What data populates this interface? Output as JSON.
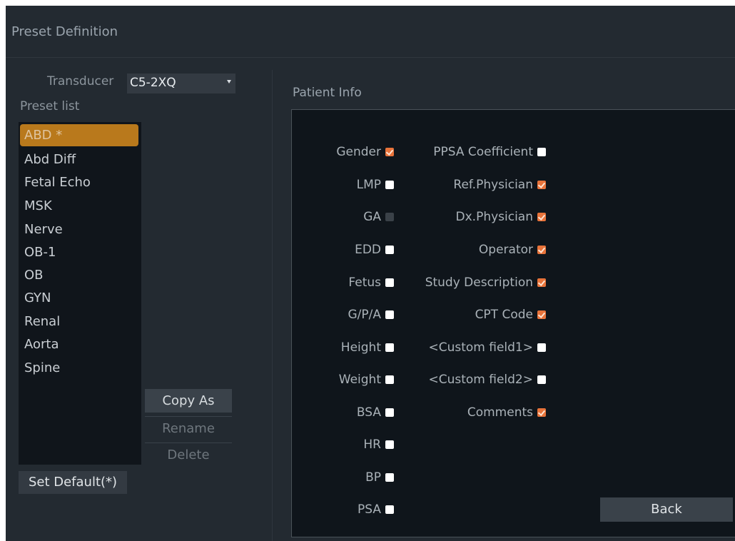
{
  "title": "Preset Definition",
  "transducer": {
    "label": "Transducer",
    "value": "C5-2XQ"
  },
  "preset_list_label": "Preset  list",
  "presets": [
    {
      "label": "ABD *",
      "selected": true
    },
    {
      "label": "Abd Diff",
      "selected": false
    },
    {
      "label": "Fetal Echo",
      "selected": false
    },
    {
      "label": "MSK",
      "selected": false
    },
    {
      "label": "Nerve",
      "selected": false
    },
    {
      "label": "OB-1",
      "selected": false
    },
    {
      "label": "OB",
      "selected": false
    },
    {
      "label": "GYN",
      "selected": false
    },
    {
      "label": "Renal",
      "selected": false
    },
    {
      "label": "Aorta",
      "selected": false
    },
    {
      "label": "Spine",
      "selected": false
    }
  ],
  "buttons": {
    "copy_as": "Copy As",
    "rename": "Rename",
    "delete": "Delete",
    "set_default": "Set Default(*)",
    "back": "Back"
  },
  "patient_info": {
    "title": "Patient Info",
    "column1": [
      {
        "label": "Gender",
        "state": "checked"
      },
      {
        "label": "LMP",
        "state": "unchecked"
      },
      {
        "label": "GA",
        "state": "disabled"
      },
      {
        "label": "EDD",
        "state": "unchecked"
      },
      {
        "label": "Fetus",
        "state": "unchecked"
      },
      {
        "label": "G/P/A",
        "state": "unchecked"
      },
      {
        "label": "Height",
        "state": "unchecked"
      },
      {
        "label": "Weight",
        "state": "unchecked"
      },
      {
        "label": "BSA",
        "state": "unchecked"
      },
      {
        "label": "HR",
        "state": "unchecked"
      },
      {
        "label": "BP",
        "state": "unchecked"
      },
      {
        "label": "PSA",
        "state": "unchecked"
      }
    ],
    "column2": [
      {
        "label": "PPSA Coefficient",
        "state": "unchecked"
      },
      {
        "label": "Ref.Physician",
        "state": "checked"
      },
      {
        "label": "Dx.Physician",
        "state": "checked"
      },
      {
        "label": "Operator",
        "state": "checked"
      },
      {
        "label": "Study Description",
        "state": "checked"
      },
      {
        "label": "CPT Code",
        "state": "checked"
      },
      {
        "label": "<Custom field1>",
        "state": "unchecked"
      },
      {
        "label": "<Custom field2>",
        "state": "unchecked"
      },
      {
        "label": "Comments",
        "state": "checked"
      }
    ]
  },
  "colors": {
    "background": "#232a31",
    "panel": "#0f151b",
    "selected": "#b9791c",
    "checkbox_on": "#e8733a",
    "checkbox_off": "#ffffff"
  }
}
